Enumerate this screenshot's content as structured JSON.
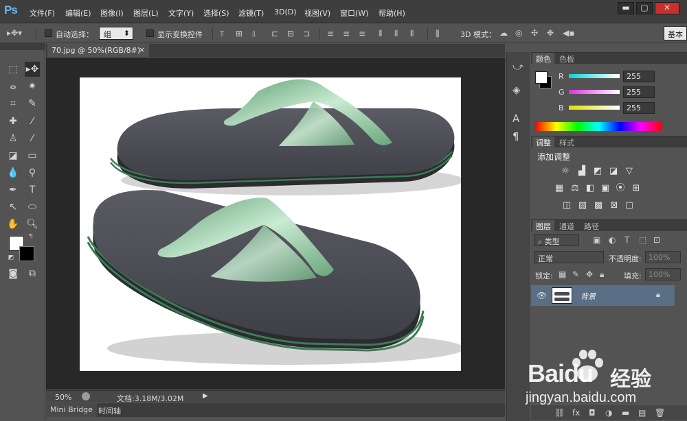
{
  "app": {
    "logo": "Ps"
  },
  "menu": [
    "文件(F)",
    "编辑(E)",
    "图像(I)",
    "图层(L)",
    "文字(Y)",
    "选择(S)",
    "滤镜(T)",
    "3D(D)",
    "视图(V)",
    "窗口(W)",
    "帮助(H)"
  ],
  "window_controls": {
    "minimize": "▬",
    "maximize": "▢",
    "close": "✕"
  },
  "options": {
    "auto_select_label": "自动选择：",
    "auto_select_value": "组",
    "show_transform_label": "显示变换控件",
    "mode_3d_label": "3D 模式：",
    "workspace_label": "基本"
  },
  "document": {
    "tab_title": "70.jpg @ 50%(RGB/8#)",
    "tab_close": "×",
    "zoom": "50%",
    "doc_info": "文档:3.18M/3.02M"
  },
  "bottom_tabs": [
    "Mini Bridge",
    "时间轴"
  ],
  "color_panel": {
    "tabs": [
      "颜色",
      "色板"
    ],
    "channels": [
      {
        "label": "R",
        "value": "255",
        "color": "#00e5e5"
      },
      {
        "label": "G",
        "value": "255",
        "color": "#e63ce6"
      },
      {
        "label": "B",
        "value": "255",
        "color": "#e6e61a"
      }
    ]
  },
  "adjust_panel": {
    "tabs": [
      "调整",
      "样式"
    ],
    "title": "添加调整"
  },
  "layers_panel": {
    "tabs": [
      "图层",
      "通道",
      "路径"
    ],
    "filter": "类型",
    "blend_mode": "正常",
    "opacity_label": "不透明度:",
    "opacity_value": "100%",
    "lock_label": "锁定:",
    "fill_label": "填充:",
    "fill_value": "100%",
    "layers": [
      {
        "name": "背景"
      }
    ]
  },
  "watermark": {
    "brand": "Baidu",
    "cn": "经验",
    "url": "jingyan.baidu.com"
  },
  "colors": {
    "accent": "#6fb3ee",
    "panel_bg": "#535353",
    "dark": "#3c3c3c",
    "layer_selected": "#5a6e85",
    "sandal_strap": "#8fcf9f",
    "sandal_sole": "#4a4a52",
    "sandal_stripe": "#3b7d55"
  }
}
